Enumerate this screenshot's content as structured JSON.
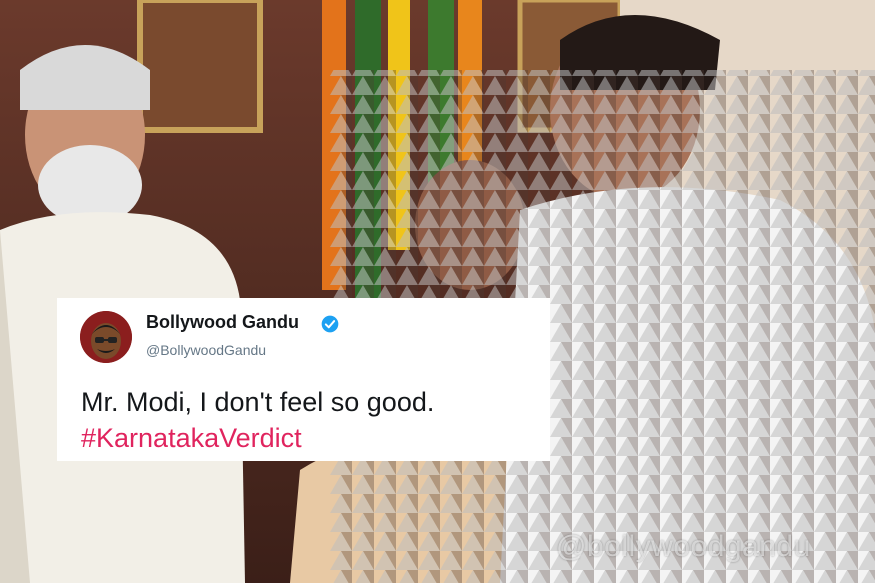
{
  "tweet": {
    "display_name": "Bollywood Gandu",
    "handle": "@BollywoodGandu",
    "text": "Mr. Modi, I don't feel so good.",
    "hashtag": "#KarnatakaVerdict",
    "verified": true,
    "hashtag_color": "#e0245e"
  },
  "watermark": "@bollywoodgandu",
  "icons": {
    "verified": "verified-badge-icon",
    "avatar": "avatar-cartoon-icon"
  }
}
